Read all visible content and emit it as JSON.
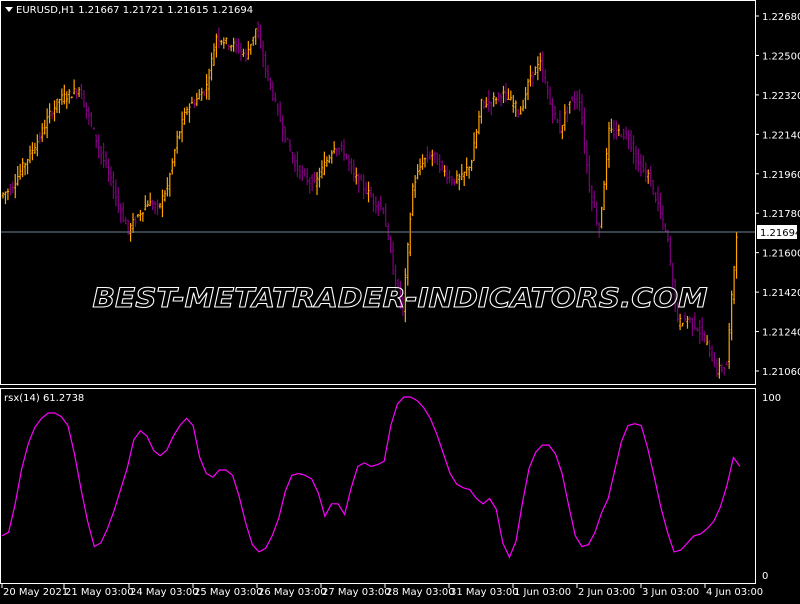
{
  "colors": {
    "background": "#000000",
    "frame": "#ffffff",
    "bull_bar": "#ffa500",
    "bear_bar": "#800080",
    "rsx_line": "#ff00ff",
    "bid_line": "#708090",
    "text": "#ffffff",
    "watermark": "#ffffff"
  },
  "header": {
    "symbol_line": "EURUSD,H1  1.21667 1.21721 1.21615 1.21694"
  },
  "price_panel": {
    "y_labels": [
      "1.22680",
      "1.22500",
      "1.22320",
      "1.22140",
      "1.21960",
      "1.21780",
      "1.21600",
      "1.21420",
      "1.21240",
      "1.21060"
    ],
    "current_price": "1.21694",
    "ylim": [
      1.2098,
      1.2278
    ]
  },
  "watermark": {
    "text": "BEST-METATRADER-INDICATORS.COM"
  },
  "rsx_panel": {
    "label": "rsx(14) 61.2738",
    "y_labels": [
      "100",
      "0"
    ],
    "ylim": [
      0,
      100
    ]
  },
  "time_axis": {
    "labels": [
      "20 May 2021",
      "21 May 03:00",
      "24 May 03:00",
      "25 May 03:00",
      "26 May 03:00",
      "27 May 03:00",
      "28 May 03:00",
      "31 May 03:00",
      "1 Jun 03:00",
      "2 Jun 03:00",
      "3 Jun 03:00",
      "4 Jun 03:00"
    ]
  },
  "chart_data": [
    {
      "type": "ohlc",
      "title": "EURUSD,H1",
      "price_points": [
        1.2186,
        1.2189,
        1.2197,
        1.2205,
        1.2213,
        1.2223,
        1.223,
        1.2232,
        1.2235,
        1.2222,
        1.2208,
        1.2196,
        1.2182,
        1.217,
        1.2177,
        1.2183,
        1.218,
        1.219,
        1.2212,
        1.2226,
        1.223,
        1.2236,
        1.2259,
        1.2256,
        1.2254,
        1.225,
        1.2262,
        1.2244,
        1.2228,
        1.2213,
        1.22,
        1.2194,
        1.2191,
        1.22,
        1.2209,
        1.2206,
        1.2195,
        1.219,
        1.2184,
        1.218,
        1.2152,
        1.2134,
        1.219,
        1.2202,
        1.2205,
        1.2198,
        1.2193,
        1.2194,
        1.2202,
        1.2228,
        1.2229,
        1.2233,
        1.2229,
        1.2224,
        1.2241,
        1.2246,
        1.2228,
        1.2216,
        1.2229,
        1.223,
        1.219,
        1.217,
        1.2215,
        1.2215,
        1.2213,
        1.22,
        1.2195,
        1.2182,
        1.2165,
        1.2128,
        1.213,
        1.2126,
        1.2118,
        1.2106,
        1.2109,
        1.2169
      ]
    },
    {
      "type": "line",
      "title": "rsx(14) 61.2738",
      "ylim": [
        0,
        100
      ],
      "values": [
        22,
        24,
        40,
        60,
        74,
        83,
        88,
        91,
        91,
        89,
        84,
        68,
        48,
        30,
        16,
        18,
        26,
        36,
        48,
        60,
        76,
        81,
        78,
        70,
        67,
        70,
        78,
        84,
        88,
        84,
        66,
        57,
        55,
        59,
        59,
        56,
        44,
        29,
        17,
        13,
        15,
        22,
        32,
        47,
        56,
        57,
        56,
        54,
        46,
        33,
        40,
        40,
        34,
        49,
        61,
        63,
        61,
        62,
        64,
        84,
        96,
        100,
        100,
        98,
        94,
        88,
        79,
        68,
        57,
        51,
        49,
        48,
        43,
        40,
        43,
        37,
        18,
        10,
        19,
        41,
        60,
        69,
        73,
        73,
        68,
        57,
        39,
        22,
        16,
        17,
        24,
        35,
        43,
        59,
        75,
        84,
        85,
        84,
        71,
        55,
        38,
        24,
        13,
        14,
        18,
        22,
        23,
        26,
        30,
        38,
        50,
        66,
        61
      ]
    }
  ]
}
